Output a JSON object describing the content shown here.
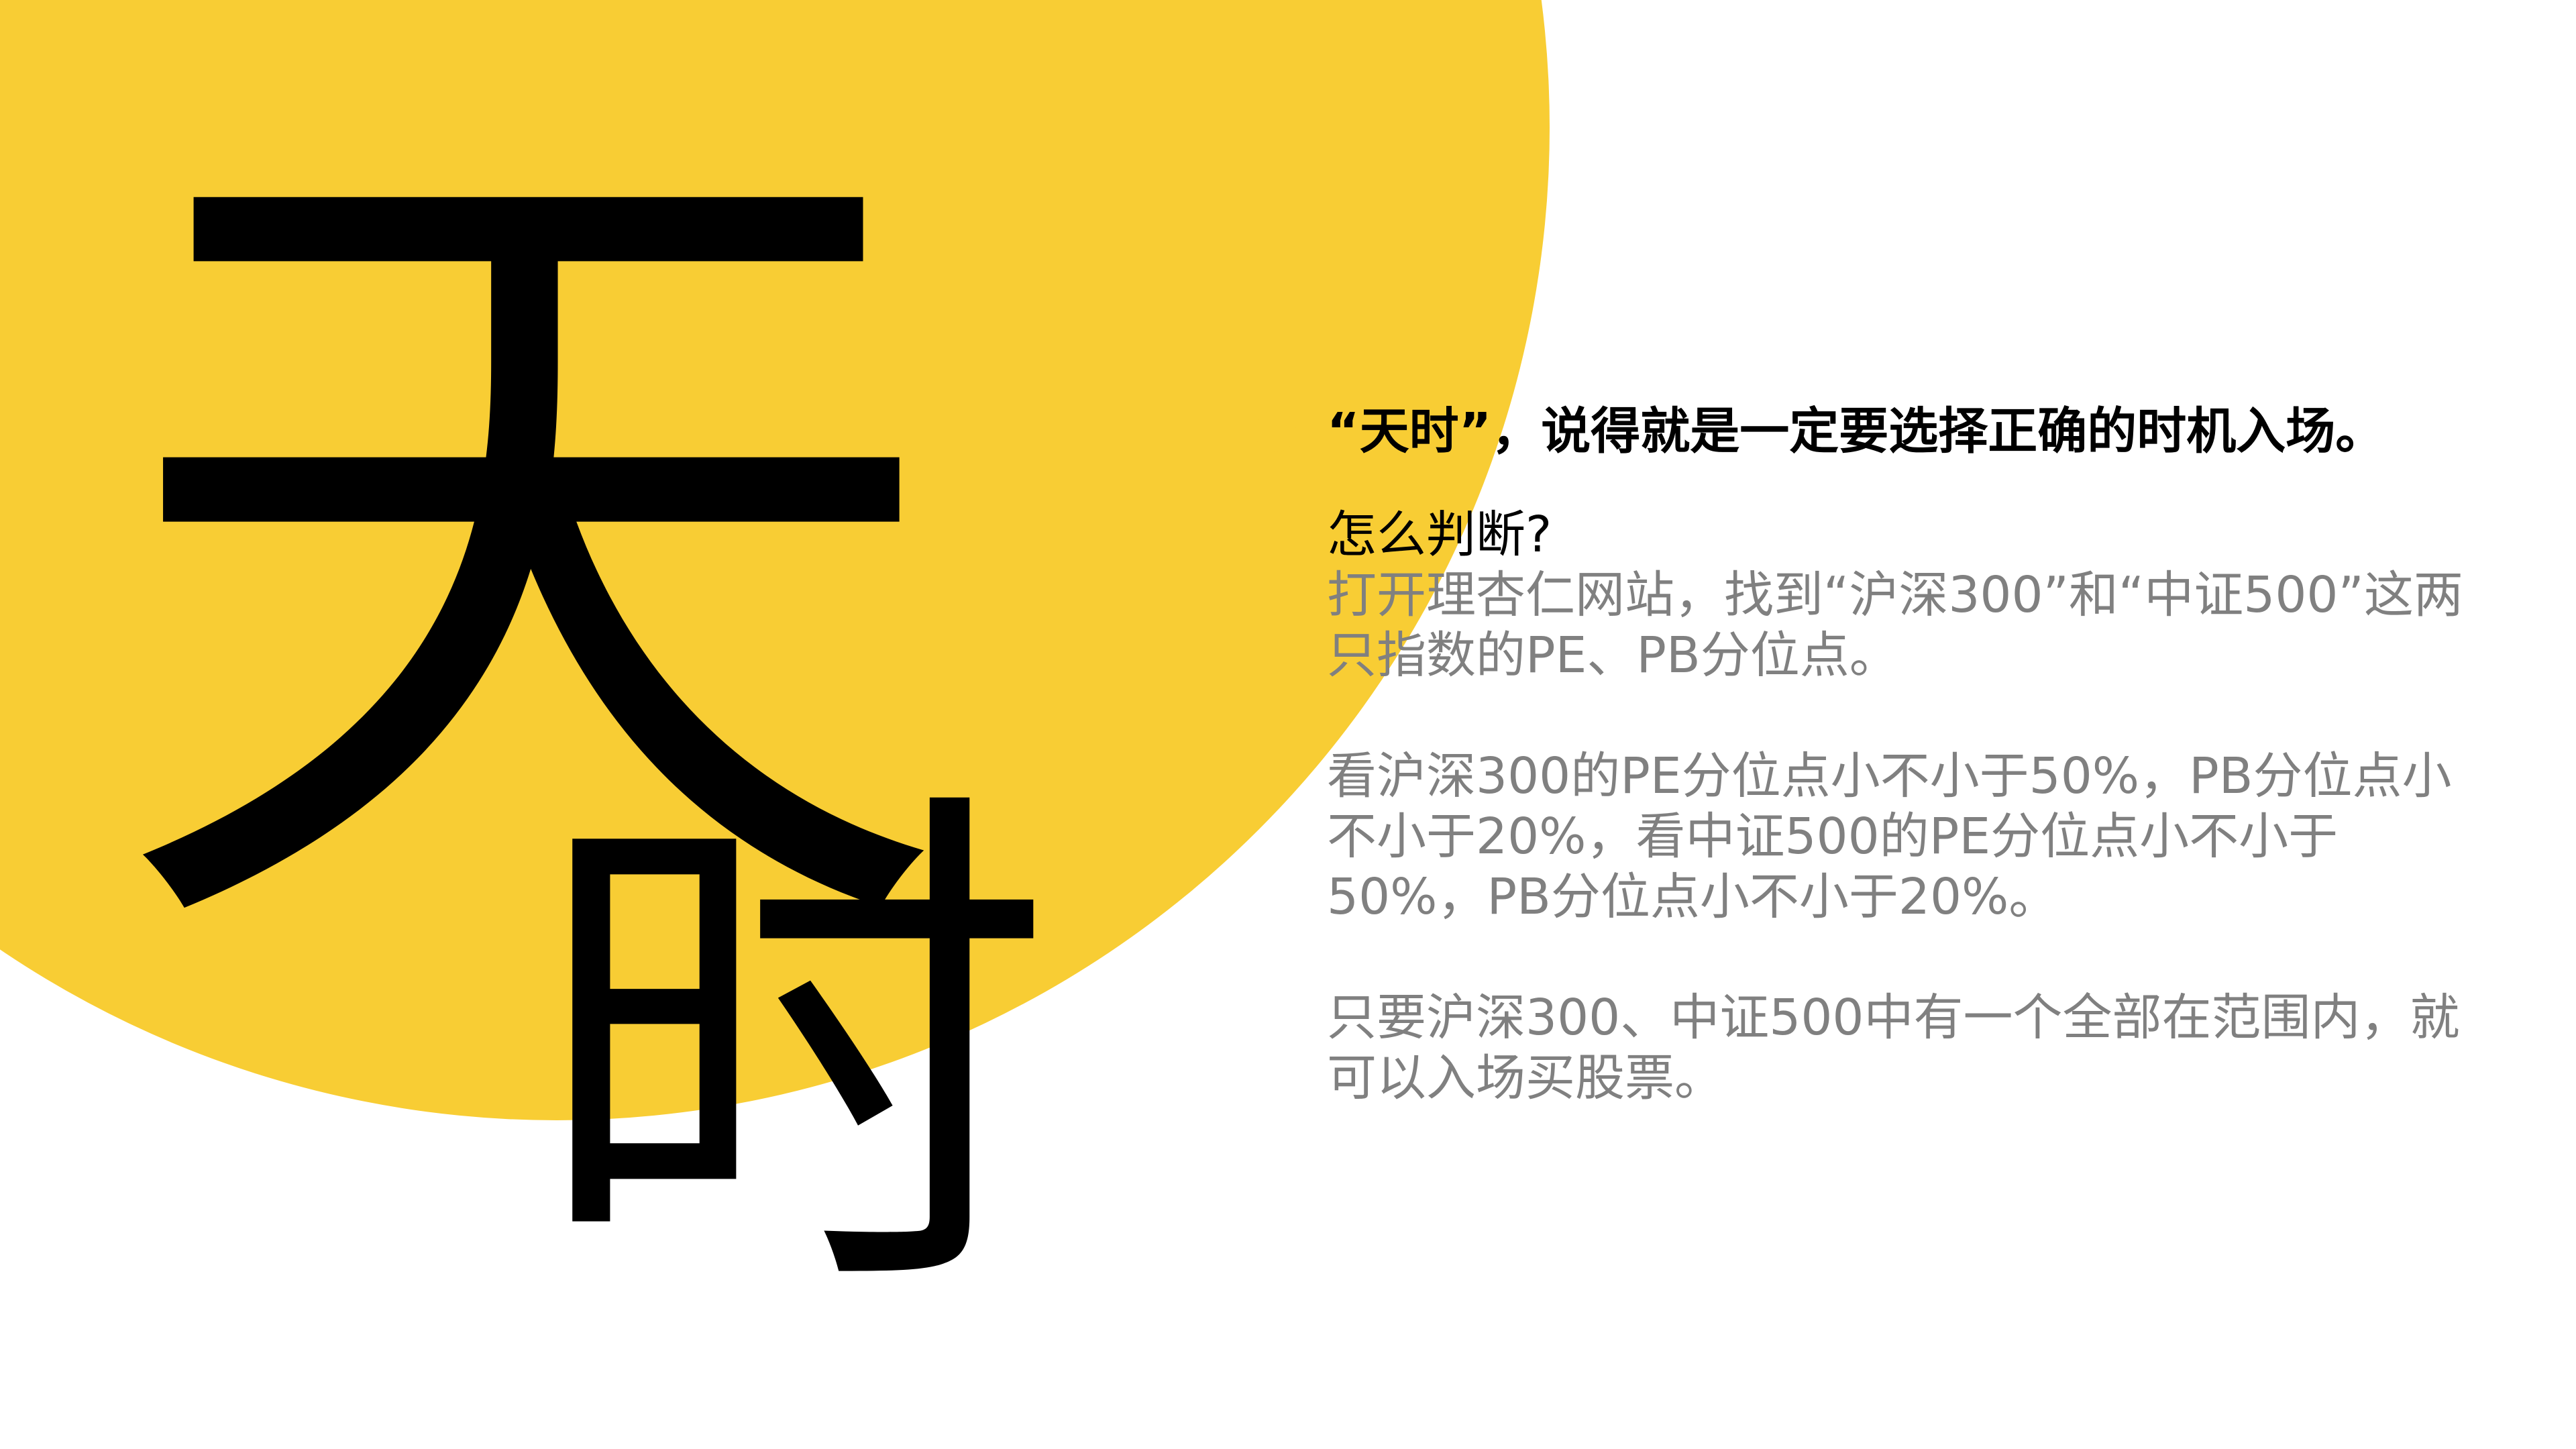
{
  "colors": {
    "accent_yellow": "#F8CD34",
    "text_dark": "#000000",
    "text_gray": "#808080",
    "background": "#FFFFFF"
  },
  "decor": {
    "char_1": "天",
    "char_2": "时"
  },
  "content": {
    "bullet_icon": "yellow-dot",
    "headline": "“天时”，说得就是一定要选择正确的时机入场。",
    "question": "怎么判断?",
    "paragraph_1": "打开理杏仁网站，找到“沪深300”和“中证500”这两只指数的PE、PB分位点。",
    "paragraph_2": "看沪深300的PE分位点小不小于50%，PB分位点小不小于20%，看中证500的PE分位点小不小于50%，PB分位点小不小于20%。",
    "paragraph_3": "只要沪深300、中证500中有一个全部在范围内，就可以入场买股票。"
  }
}
